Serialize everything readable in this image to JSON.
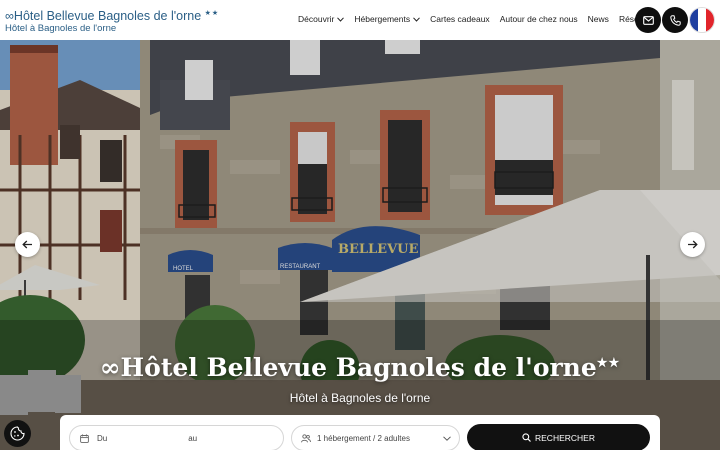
{
  "logo": {
    "title": "∞Hôtel Bellevue Bagnoles de l'orne",
    "stars": "★★",
    "subtitle": "Hôtel à Bagnoles de l'orne"
  },
  "nav": {
    "items": [
      {
        "label": "Découvrir",
        "has_dropdown": true
      },
      {
        "label": "Hébergements",
        "has_dropdown": true
      },
      {
        "label": "Cartes cadeaux",
        "has_dropdown": false
      },
      {
        "label": "Autour de chez nous",
        "has_dropdown": false
      },
      {
        "label": "News",
        "has_dropdown": false
      },
      {
        "label": "Réserver",
        "has_dropdown": false
      }
    ]
  },
  "header_buttons": {
    "email_icon": "mail-icon",
    "phone_icon": "phone-icon",
    "language_icon": "french-flag-icon"
  },
  "hero": {
    "title": "∞Hôtel Bellevue Bagnoles de l'orne",
    "stars": "★★",
    "subtitle": "Hôtel à Bagnoles de l'orne",
    "facade_sign": "BELLEVUE",
    "awning_left": "HOTEL",
    "awning_right": "RESTAURANT",
    "prev_icon": "arrow-left-icon",
    "next_icon": "arrow-right-icon"
  },
  "booking": {
    "date_from_label": "Du",
    "date_to_label": "au",
    "guests_label": "1 hébergement / 2 adultes",
    "search_label": "RECHERCHER"
  },
  "colors": {
    "brand": "#2b5f86",
    "button_dark": "#111111",
    "flag_blue": "#1f3fa0",
    "flag_red": "#e1242b"
  }
}
